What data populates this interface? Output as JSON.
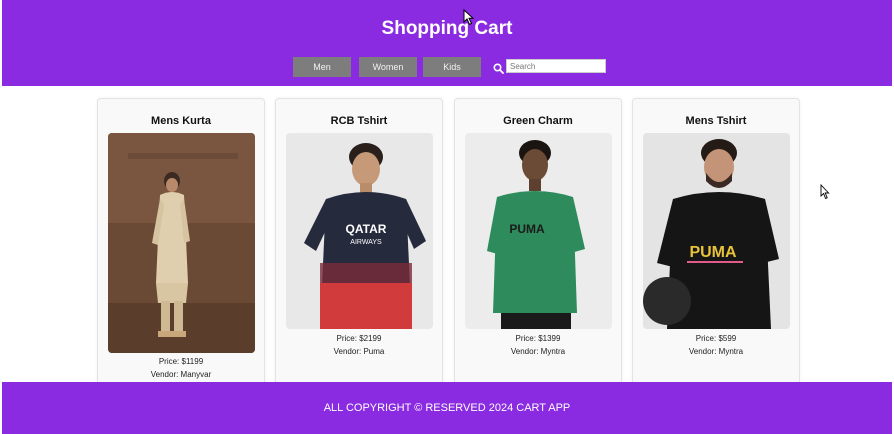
{
  "header": {
    "title": "Shopping Cart",
    "nav": [
      {
        "label": "Men"
      },
      {
        "label": "Women"
      },
      {
        "label": "Kids"
      }
    ],
    "search": {
      "placeholder": "Search",
      "icon": "search-icon"
    }
  },
  "products": [
    {
      "name": "Mens Kurta",
      "price": "Price: $1199",
      "vendor": "Vendor: Manyvar"
    },
    {
      "name": "RCB Tshirt",
      "price": "Price: $2199",
      "vendor": "Vendor: Puma"
    },
    {
      "name": "Green Charm",
      "price": "Price: $1399",
      "vendor": "Vendor: Myntra"
    },
    {
      "name": "Mens Tshirt",
      "price": "Price: $599",
      "vendor": "Vendor: Myntra"
    }
  ],
  "footer": {
    "text": "ALL COPYRIGHT © RESERVED 2024 CART APP"
  },
  "colors": {
    "brand": "#8a2be2",
    "nav_button": "#7d7d7d"
  }
}
